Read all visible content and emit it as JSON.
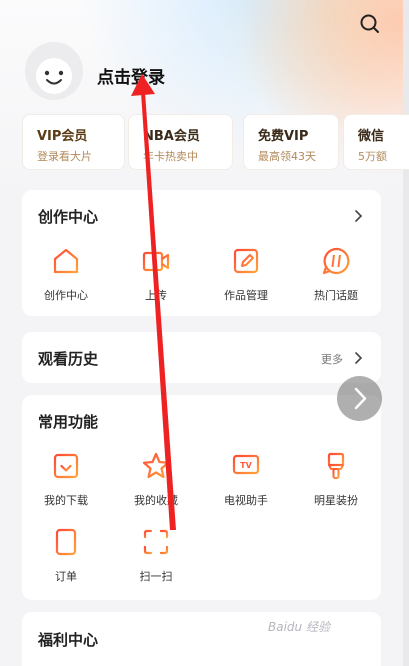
{
  "header": {
    "login_text": "点击登录",
    "search_icon": "search-icon"
  },
  "vip_cards": [
    {
      "title": "VIP会员",
      "subtitle": "登录看大片"
    },
    {
      "title": "NBA会员",
      "subtitle": "年卡热卖中"
    },
    {
      "title": "免费VIP",
      "subtitle": "最高领43天"
    },
    {
      "title": "微信",
      "subtitle": "5万额"
    }
  ],
  "creation": {
    "title": "创作中心",
    "items": [
      {
        "label": "创作中心",
        "icon": "home-plus-icon"
      },
      {
        "label": "上传",
        "icon": "video-upload-icon"
      },
      {
        "label": "作品管理",
        "icon": "edit-document-icon"
      },
      {
        "label": "热门话题",
        "icon": "hashtag-icon"
      }
    ]
  },
  "history": {
    "title": "观看历史",
    "more": "更多"
  },
  "functions": {
    "title": "常用功能",
    "items": [
      {
        "label": "我的下载",
        "icon": "download-icon"
      },
      {
        "label": "我的收藏",
        "icon": "star-icon"
      },
      {
        "label": "电视助手",
        "icon": "tv-icon"
      },
      {
        "label": "明星装扮",
        "icon": "brush-icon"
      },
      {
        "label": "订单",
        "icon": "order-icon"
      },
      {
        "label": "扫一扫",
        "icon": "scan-icon"
      }
    ]
  },
  "welfare": {
    "title": "福利中心"
  },
  "watermark": "Baidu 经验",
  "colors": {
    "accent_start": "#ff5a3c",
    "accent_end": "#ff9a3c",
    "annotation_arrow": "#ee2222"
  }
}
